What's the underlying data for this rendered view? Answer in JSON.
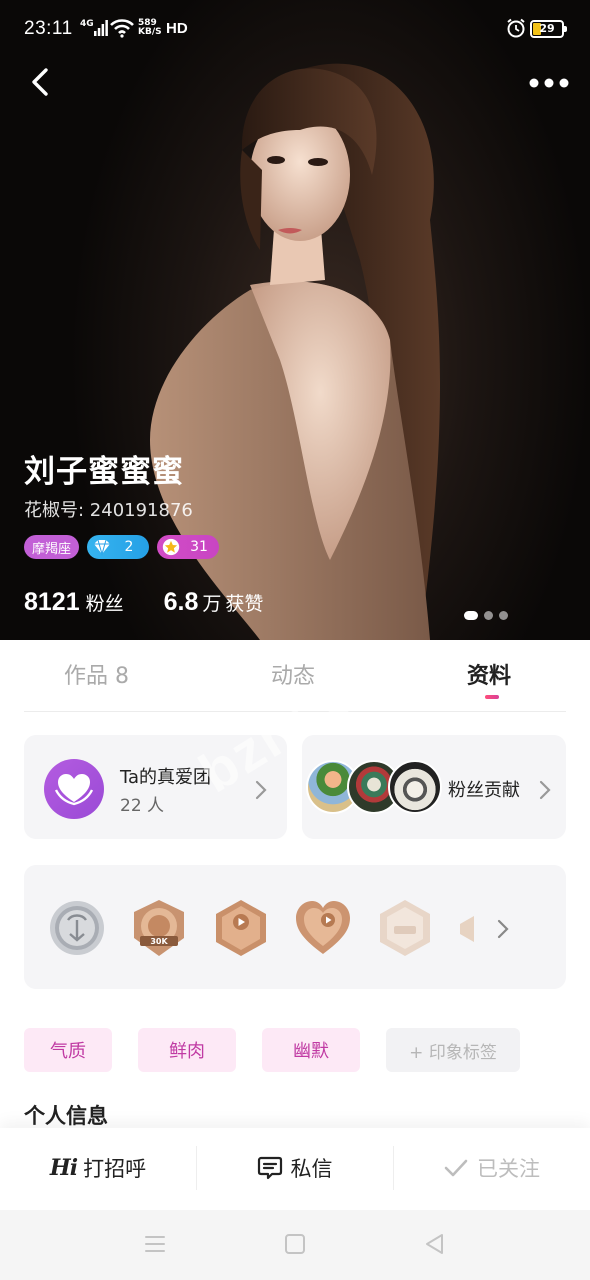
{
  "status_bar": {
    "time": "23:11",
    "network": "4G",
    "speed_value": "589",
    "speed_unit": "KB/S",
    "hd": "HD",
    "battery": "29",
    "battery_fraction": 0.29
  },
  "profile": {
    "name": "刘子蜜蜜蜜",
    "id_text": "花椒号: 240191876",
    "badges": {
      "zodiac": "摩羯座",
      "diamond_level": "2",
      "star_level": "31"
    },
    "fans_count": "8121",
    "fans_label": "粉丝",
    "likes_count": "6.8",
    "likes_unit": "万",
    "likes_label": "获赞",
    "photo_count": 3,
    "photo_index": 1
  },
  "tabs": [
    {
      "label": "作品 8"
    },
    {
      "label": "动态"
    },
    {
      "label": "资料",
      "active": true
    }
  ],
  "love_group": {
    "title": "Ta的真爱团",
    "count": "22 人"
  },
  "fans_contribution": {
    "label": "粉丝贡献"
  },
  "medals": {
    "icons": [
      "rank-medal-icon",
      "30k-medal-icon",
      "video-medal-icon",
      "heart-video-medal-icon",
      "faded-medal-icon",
      "partial-medal-icon"
    ],
    "medal_30k_label": "30K"
  },
  "impression_tags": [
    "气质",
    "鲜肉",
    "幽默"
  ],
  "add_tag_label": "+ 印象标签",
  "section_title": "个人信息",
  "actions": {
    "hi_mark": "Hi",
    "greet": "打招呼",
    "message": "私信",
    "followed": "已关注"
  },
  "watermark": "bzhi.c",
  "colors": {
    "accent_pink": "#d84098",
    "badge_purple": "#c25fd6",
    "badge_blue": "#36b4ef",
    "tag_bg": "#fde9f6",
    "tag_text": "#c03aa3"
  }
}
